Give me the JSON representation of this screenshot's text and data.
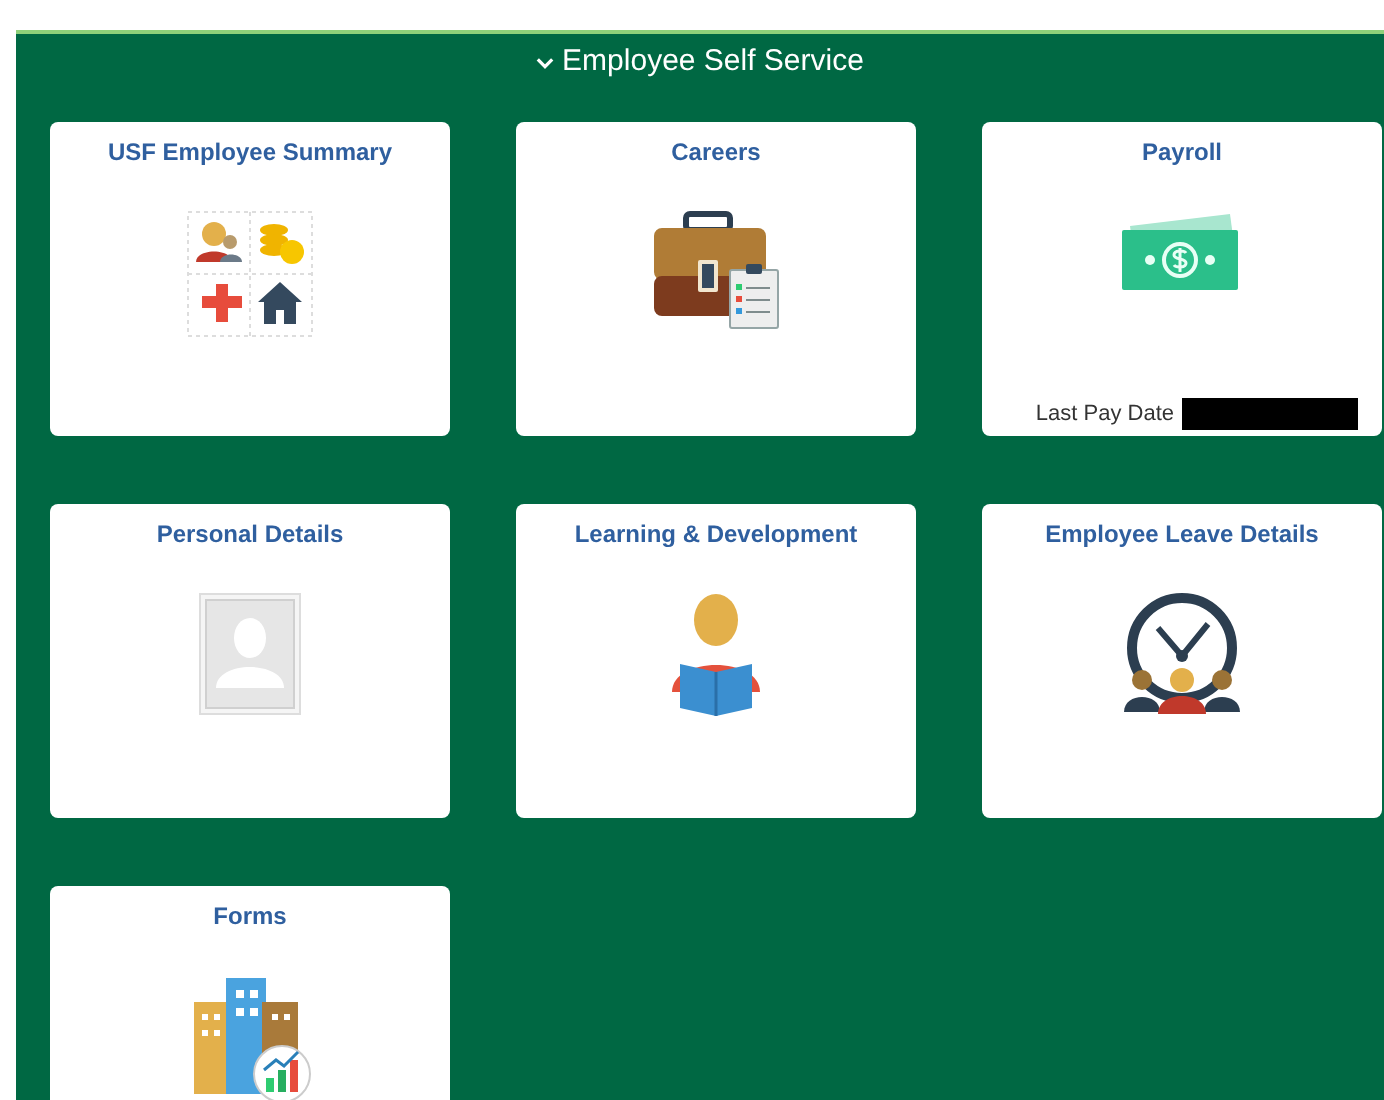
{
  "header": {
    "title": "Employee Self Service",
    "expanded": true
  },
  "tiles": [
    {
      "title": "USF Employee Summary"
    },
    {
      "title": "Careers"
    },
    {
      "title": "Payroll",
      "footer_label": "Last Pay Date"
    },
    {
      "title": "Personal Details"
    },
    {
      "title": "Learning & Development"
    },
    {
      "title": "Employee Leave Details"
    },
    {
      "title": "Forms"
    }
  ]
}
